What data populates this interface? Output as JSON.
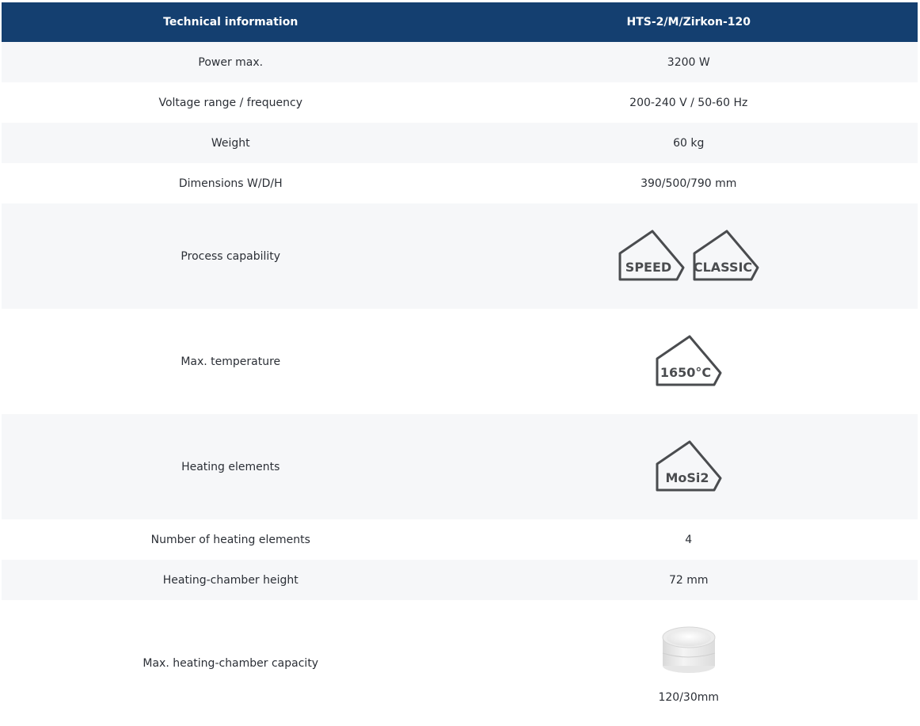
{
  "header": {
    "left": "Technical information",
    "right": "HTS-2/M/Zirkon-120"
  },
  "rows": [
    {
      "label": "Power max.",
      "value": "3200 W"
    },
    {
      "label": "Voltage range / frequency",
      "value": "200-240 V / 50-60 Hz"
    },
    {
      "label": "Weight",
      "value": "60 kg"
    },
    {
      "label": "Dimensions W/D/H",
      "value": "390/500/790 mm"
    },
    {
      "label": "Process capability",
      "badges": [
        "SPEED",
        "CLASSIC"
      ],
      "badge_icon": "house-badge-icon"
    },
    {
      "label": "Max. temperature",
      "badges": [
        "1650°C"
      ],
      "badge_icon": "house-badge-icon"
    },
    {
      "label": "Heating elements",
      "badges": [
        "MoSi2"
      ],
      "badge_icon": "house-badge-icon"
    },
    {
      "label": "Number of heating elements",
      "value": "4"
    },
    {
      "label": "Heating-chamber height",
      "value": "72 mm"
    },
    {
      "label": "Max. heating-chamber capacity",
      "value": "120/30mm",
      "image_icon": "crucible-tray-icon"
    }
  ],
  "colors": {
    "header_bg": "#143f70",
    "row_alt": "#f6f7f9",
    "badge_stroke": "#4a4c4f"
  }
}
